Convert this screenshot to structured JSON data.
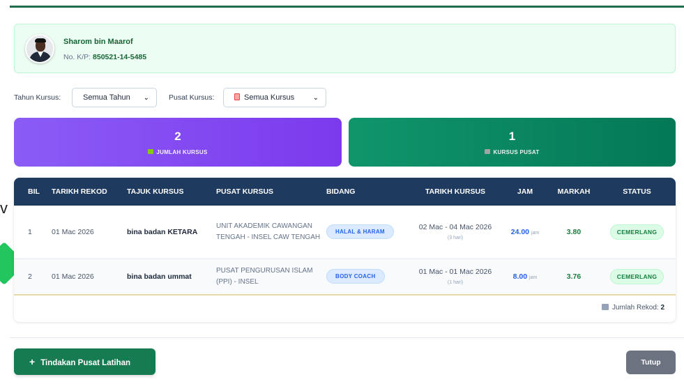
{
  "edge_text": "v",
  "user": {
    "name": "Sharom bin Maarof",
    "ic_label": "No. K/P:",
    "ic_value": "850521-14-5485"
  },
  "filters": {
    "year_label": "Tahun Kursus:",
    "year_value": "Semua Tahun",
    "center_label": "Pusat Kursus:",
    "center_value": "Semua Kursus"
  },
  "stats": [
    {
      "value": "2",
      "label": "JUMLAH KURSUS",
      "icon": "chart-icon"
    },
    {
      "value": "1",
      "label": "KURSUS PUSAT",
      "icon": "building-icon"
    }
  ],
  "table": {
    "headers": [
      "BIL",
      "TARIKH REKOD",
      "TAJUK KURSUS",
      "PUSAT KURSUS",
      "BIDANG",
      "TARIKH KURSUS",
      "JAM",
      "MARKAH",
      "STATUS"
    ],
    "rows": [
      {
        "bil": "1",
        "tarikh_rekod": "01 Mac 2026",
        "tajuk": "bina badan KETARA",
        "pusat": "UNIT AKADEMIK CAWANGAN TENGAH - INSEL CAW TENGAH",
        "bidang": "HALAL & HARAM",
        "tarikh_kursus": "02 Mac - 04 Mac 2026",
        "hari": "(3 hari)",
        "jam": "24.00",
        "jam_unit": "jam",
        "markah": "3.80",
        "status": "CEMERLANG"
      },
      {
        "bil": "2",
        "tarikh_rekod": "01 Mac 2026",
        "tajuk": "bina badan ummat",
        "pusat": "PUSAT PENGURUSAN ISLAM (PPI) - INSEL",
        "bidang": "BODY COACH",
        "tarikh_kursus": "01 Mac - 01 Mac 2026",
        "hari": "(1 hari)",
        "jam": "8.00",
        "jam_unit": "jam",
        "markah": "3.76",
        "status": "CEMERLANG"
      }
    ],
    "footer_label": "Jumlah Rekod:",
    "footer_count": "2"
  },
  "buttons": {
    "primary": "Tindakan Pusat Latihan",
    "close": "Tutup"
  },
  "colors": {
    "header_bg": "#1e3a5f",
    "accent_green": "#177b52",
    "accent_purple": "#7c3aed"
  }
}
